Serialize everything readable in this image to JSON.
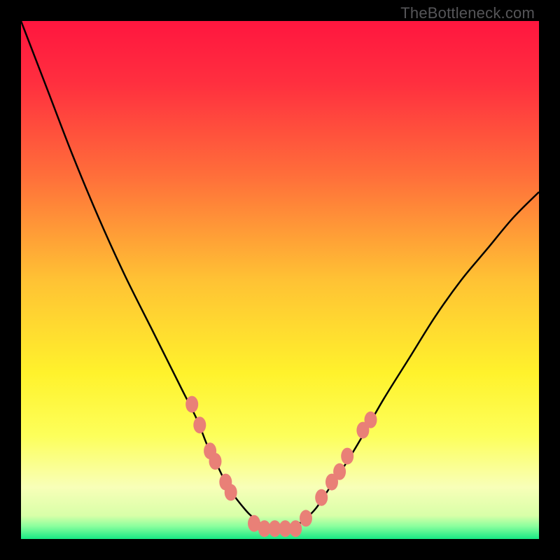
{
  "watermark": "TheBottleneck.com",
  "chart_data": {
    "type": "line",
    "title": "",
    "xlabel": "",
    "ylabel": "",
    "xlim": [
      0,
      100
    ],
    "ylim": [
      0,
      100
    ],
    "grid": false,
    "background": {
      "type": "vertical-gradient",
      "stops": [
        {
          "pos": 0.0,
          "color": "#ff163f"
        },
        {
          "pos": 0.12,
          "color": "#ff2f3f"
        },
        {
          "pos": 0.3,
          "color": "#ff6f3a"
        },
        {
          "pos": 0.5,
          "color": "#ffc234"
        },
        {
          "pos": 0.68,
          "color": "#fff22c"
        },
        {
          "pos": 0.8,
          "color": "#fdff5a"
        },
        {
          "pos": 0.9,
          "color": "#f8ffb8"
        },
        {
          "pos": 0.955,
          "color": "#d8ffa8"
        },
        {
          "pos": 0.975,
          "color": "#8cff9e"
        },
        {
          "pos": 1.0,
          "color": "#17e884"
        }
      ]
    },
    "series": [
      {
        "name": "bottleneck-curve",
        "color": "#000000",
        "x": [
          0,
          5,
          10,
          15,
          20,
          25,
          28,
          31,
          34,
          36,
          38,
          40,
          43,
          45,
          48,
          52,
          55,
          57,
          59,
          61,
          63,
          66,
          70,
          75,
          80,
          85,
          90,
          95,
          100
        ],
        "values": [
          100,
          87,
          74,
          62,
          51,
          41,
          35,
          29,
          23,
          18,
          14,
          10,
          6,
          4,
          2,
          2,
          4,
          6,
          9,
          12,
          15,
          20,
          27,
          35,
          43,
          50,
          56,
          62,
          67
        ]
      }
    ],
    "markers": {
      "name": "highlighted-points",
      "color": "#e98077",
      "points": [
        {
          "x": 33.0,
          "y": 26
        },
        {
          "x": 34.5,
          "y": 22
        },
        {
          "x": 36.5,
          "y": 17
        },
        {
          "x": 37.5,
          "y": 15
        },
        {
          "x": 39.5,
          "y": 11
        },
        {
          "x": 40.5,
          "y": 9
        },
        {
          "x": 45.0,
          "y": 3
        },
        {
          "x": 47.0,
          "y": 2
        },
        {
          "x": 49.0,
          "y": 2
        },
        {
          "x": 51.0,
          "y": 2
        },
        {
          "x": 53.0,
          "y": 2
        },
        {
          "x": 55.0,
          "y": 4
        },
        {
          "x": 58.0,
          "y": 8
        },
        {
          "x": 60.0,
          "y": 11
        },
        {
          "x": 61.5,
          "y": 13
        },
        {
          "x": 63.0,
          "y": 16
        },
        {
          "x": 66.0,
          "y": 21
        },
        {
          "x": 67.5,
          "y": 23
        }
      ]
    }
  }
}
